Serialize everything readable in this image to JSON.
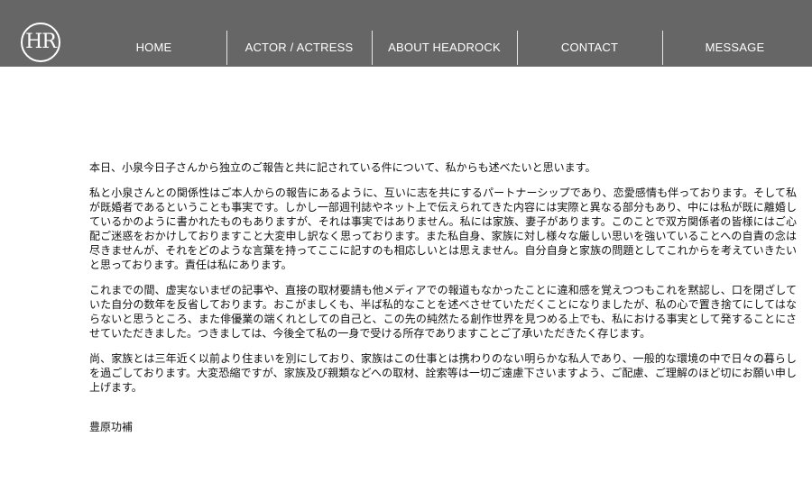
{
  "logo": {
    "text": "HR"
  },
  "nav": {
    "items": [
      {
        "label": "HOME"
      },
      {
        "label": "ACTOR / ACTRESS"
      },
      {
        "label": "ABOUT HEADROCK"
      },
      {
        "label": "CONTACT"
      },
      {
        "label": "MESSAGE"
      }
    ]
  },
  "content": {
    "paragraphs": [
      "本日、小泉今日子さんから独立のご報告と共に記されている件について、私からも述べたいと思います。",
      "私と小泉さんとの関係性はご本人からの報告にあるように、互いに志を共にするパートナーシップであり、恋愛感情も伴っております。そして私が既婚者であるということも事実です。しかし一部週刊誌やネット上で伝えられてきた内容には実際と異なる部分もあり、中には私が既に離婚しているかのように書かれたものもありますが、それは事実ではありません。私には家族、妻子があります。このことで双方関係者の皆様にはご心配ご迷惑をおかけしておりますこと大変申し訳なく思っております。また私自身、家族に対し様々な厳しい思いを強いていることへの自責の念は尽きませんが、それをどのような言葉を持ってここに記すのも相応しいとは思えません。自分自身と家族の問題としてこれからを考えていきたいと思っております。責任は私にあります。",
      "これまでの間、虚実ないまぜの記事や、直接の取材要請も他メディアでの報道もなかったことに違和感を覚えつつもこれを黙認し、口を閉ざしていた自分の数年を反省しております。おこがましくも、半ば私的なことを述べさせていただくことになりましたが、私の心で置き捨てにしてはならないと思うところ、また俳優業の端くれとしての自己と、この先の純然たる創作世界を見つめる上でも、私における事実として発することにさせていただきました。つきましては、今後全て私の一身で受ける所存でありますことご了承いただきたく存じます。",
      "尚、家族とは三年近く以前より住まいを別にしており、家族はこの仕事とは携わりのない明らかな私人であり、一般的な環境の中で日々の暮らしを過ごしております。大変恐縮ですが、家族及び親類などへの取材、詮索等は一切ご遠慮下さいますよう、ご配慮、ご理解のほど切にお願い申し上げます。"
    ],
    "signature": "豊原功補"
  }
}
